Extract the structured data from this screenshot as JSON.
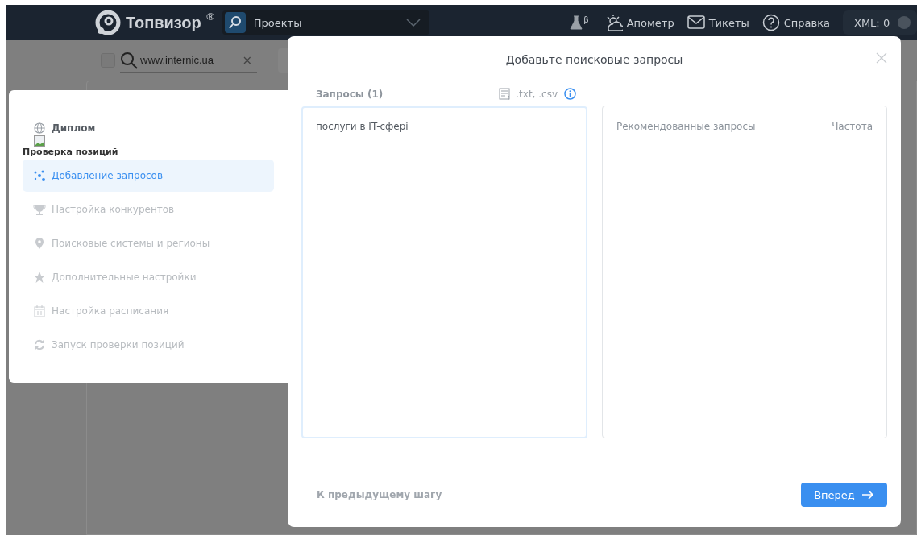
{
  "header": {
    "logo": "Топвизор",
    "logo_mark": "®",
    "project_select": {
      "value": "Проекты"
    },
    "lab_badge": "β",
    "nav": [
      {
        "label": "Апометр"
      },
      {
        "label": "Тикеты"
      },
      {
        "label": "Справка"
      }
    ],
    "xml": "XML: 0"
  },
  "background": {
    "search": {
      "value": "www.internic.ua"
    },
    "clear": "×",
    "checked": false
  },
  "sidebar": {
    "project": "Диплом",
    "section": "Проверка позиций",
    "steps": [
      {
        "label": "Добавление запросов",
        "selected": true
      },
      {
        "label": "Настройка конкурентов",
        "selected": false
      },
      {
        "label": "Поисковые системы и регионы",
        "selected": false
      },
      {
        "label": "Дополнительные настройки",
        "selected": false
      },
      {
        "label": "Настройка расписания",
        "selected": false
      },
      {
        "label": "Запуск проверки позиций",
        "selected": false
      }
    ]
  },
  "modal": {
    "title": "Добавьте поисковые запросы",
    "queries_label": "Запросы (1)",
    "import_label": ".txt, .csv",
    "queries": {
      "value": "послуги в IT-сфері"
    },
    "recommended": {
      "columns": [
        "Рекомендованные запросы",
        "Частота"
      ]
    },
    "back": "К предыдущему шагу",
    "next": "Вперед"
  }
}
